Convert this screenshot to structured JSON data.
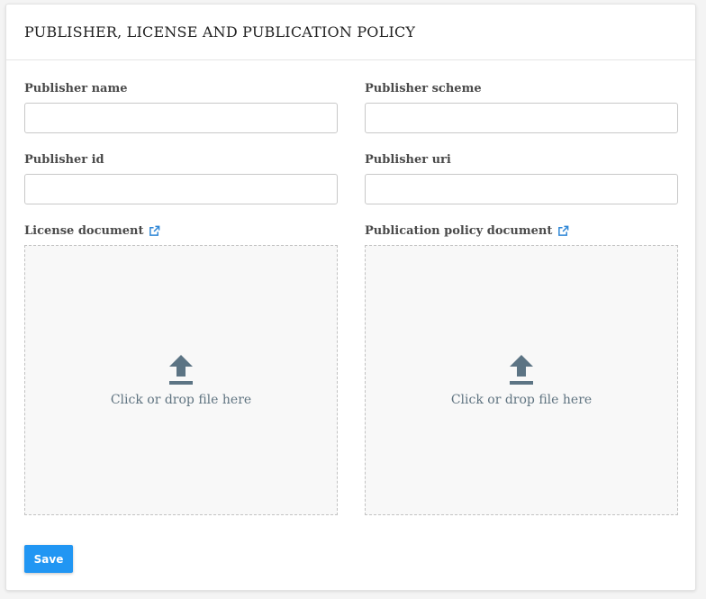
{
  "panel": {
    "title": "PUBLISHER, LICENSE AND PUBLICATION POLICY"
  },
  "fields": {
    "publisher_name": {
      "label": "Publisher name",
      "value": ""
    },
    "publisher_scheme": {
      "label": "Publisher scheme",
      "value": ""
    },
    "publisher_id": {
      "label": "Publisher id",
      "value": ""
    },
    "publisher_uri": {
      "label": "Publisher uri",
      "value": ""
    }
  },
  "uploads": {
    "license": {
      "label": "License document",
      "icon": "external-link-icon",
      "dropzone_text": "Click or drop file here"
    },
    "policy": {
      "label": "Publication policy document",
      "icon": "external-link-icon",
      "dropzone_text": "Click or drop file here"
    }
  },
  "actions": {
    "save_label": "Save"
  },
  "colors": {
    "accent": "#2196f3",
    "link_icon": "#2e86d6",
    "upload_icon": "#5c7484"
  }
}
